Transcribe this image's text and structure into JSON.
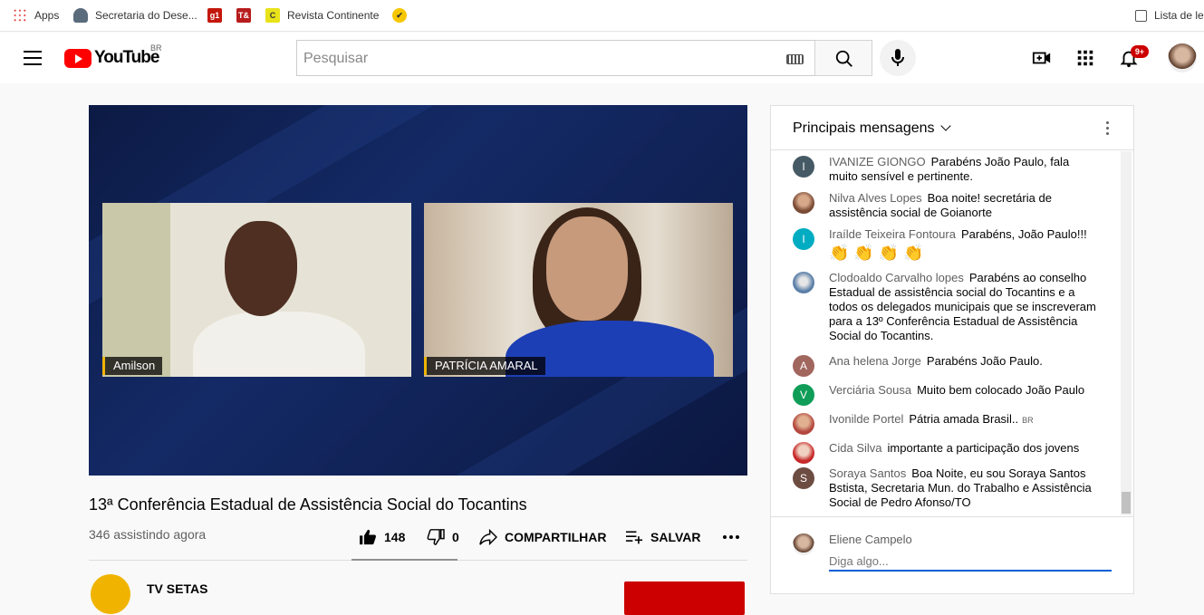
{
  "bookmarks": {
    "items": [
      {
        "label": "Apps",
        "icon": "apps-grid-icon"
      },
      {
        "label": "Secretaria do Dese...",
        "icon": "car-icon"
      },
      {
        "label": "",
        "icon": "g1-icon",
        "badge": "g1"
      },
      {
        "label": "",
        "icon": "news-icon",
        "badge": "T&"
      },
      {
        "label": "Revista Continente",
        "icon": "continente-icon",
        "badge": "C"
      },
      {
        "label": "",
        "icon": "check-badge-icon"
      }
    ],
    "reading_list": "Lista de le"
  },
  "header": {
    "logo_text": "YouTube",
    "country": "BR",
    "search_placeholder": "Pesquisar",
    "notification_count": "9+",
    "colors": {
      "brand": "#ff0000",
      "badge": "#cc0000"
    }
  },
  "video": {
    "participants": [
      {
        "name": "Amilson"
      },
      {
        "name": "PATRÍCIA AMARAL"
      }
    ],
    "title": "13ª Conferência Estadual de Assistência Social do Tocantins",
    "viewers": "346 assistindo agora",
    "likes": "148",
    "dislikes": "0",
    "share_label": "COMPARTILHAR",
    "save_label": "SALVAR"
  },
  "channel": {
    "name": "TV SETAS"
  },
  "chat": {
    "title": "Principais mensagens",
    "messages": [
      {
        "author": "IVANIZE GIONGO",
        "text": "Parabéns João Paulo, fala muito sensível e pertinente.",
        "avatar_letter": "I",
        "avatar_color": "#455a64"
      },
      {
        "author": "Nilva Alves Lopes",
        "text": "Boa noite! secretária de assistência social de Goianorte",
        "avatar_letter": "",
        "avatar_color": "#8d5a4a"
      },
      {
        "author": "Iraílde Teixeira Fontoura",
        "text": "Parabéns, João Paulo!!!",
        "avatar_letter": "I",
        "avatar_color": "#00acc1",
        "claps": "👏 👏 👏 👏"
      },
      {
        "author": "Clodoaldo Carvalho lopes",
        "text": "Parabéns ao conselho Estadual de assistência social do Tocantins e a todos os delegados municipais que se inscreveram para a 13º Conferência Estadual de Assistência Social do Tocantins.",
        "avatar_letter": "",
        "avatar_color": "#5b7fa8"
      },
      {
        "author": "Ana helena Jorge",
        "text": "Parabéns João Paulo.",
        "avatar_letter": "A",
        "avatar_color": "#a1665e"
      },
      {
        "author": "Verciária Sousa",
        "text": "Muito bem colocado João Paulo",
        "avatar_letter": "V",
        "avatar_color": "#0f9d58"
      },
      {
        "author": "Ivonilde Portel",
        "text": "Pátria amada Brasil..",
        "badge": "BR",
        "avatar_letter": "",
        "avatar_color": "#b4483f"
      },
      {
        "author": "Cida Silva",
        "text": "importante a participação dos jovens",
        "avatar_letter": "",
        "avatar_color": "#c62828"
      },
      {
        "author": "Soraya Santos",
        "text": "Boa Noite, eu sou Soraya Santos Bstista, Secretaria Mun. do Trabalho e Assistência Social de Pedro Afonso/TO",
        "avatar_letter": "S",
        "avatar_color": "#6d4c41"
      }
    ],
    "current_user": "Eliene Campelo",
    "input_placeholder": "Diga algo..."
  }
}
